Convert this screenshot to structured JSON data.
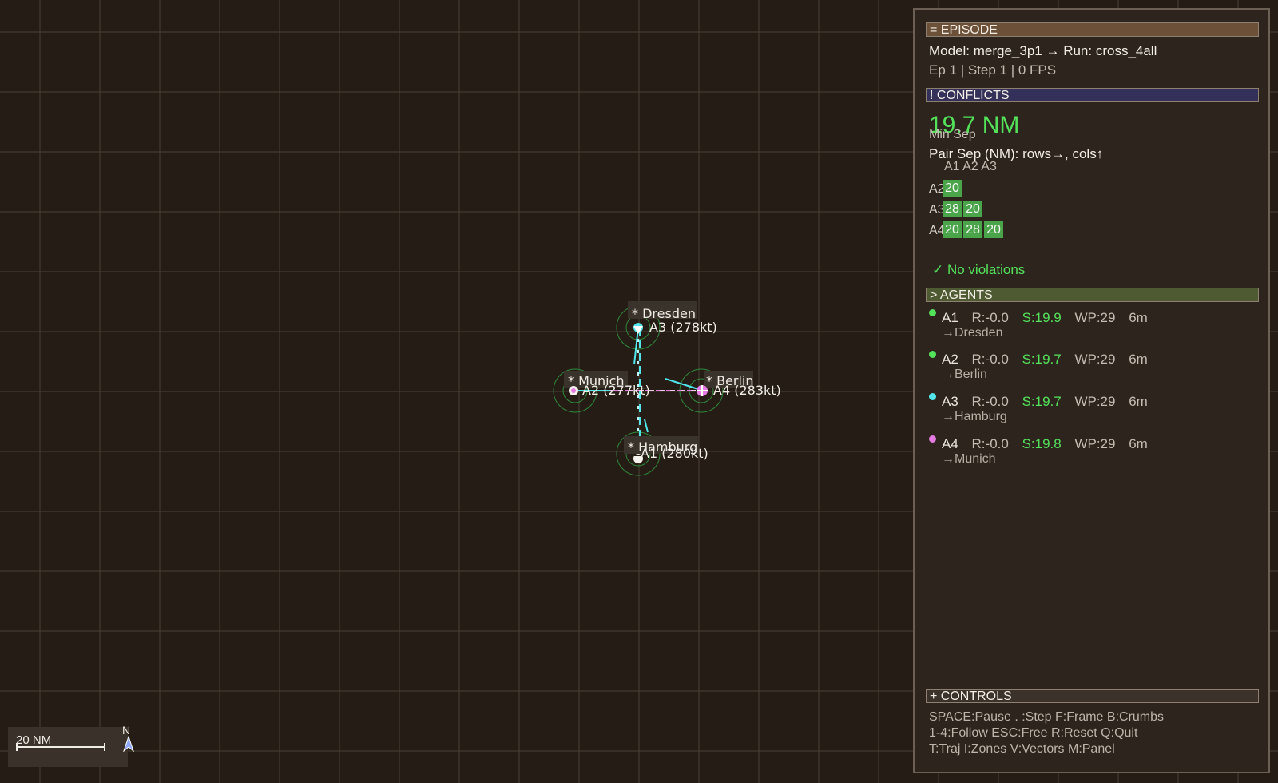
{
  "map": {
    "cities": [
      {
        "name": "* Dresden"
      },
      {
        "name": "* Munich"
      },
      {
        "name": "* Berlin"
      },
      {
        "name": "* Hamburg"
      }
    ],
    "aircraft_labels": [
      {
        "id": "A3",
        "text": "A3 (278kt)"
      },
      {
        "id": "A4",
        "text": "A4 (283kt)"
      },
      {
        "id": "A2",
        "text": "A2 (277kt)"
      },
      {
        "id": "A1",
        "text": "A1 (280kt)"
      }
    ],
    "scale_label": "20 NM",
    "north_label": "N"
  },
  "colors": {
    "background": "#241c15",
    "grid": "#4a4038",
    "agent_A1": "#53e25a",
    "agent_A2": "#53e25a",
    "agent_A3": "#52e6ec",
    "agent_A4": "#e57be2"
  },
  "panel": {
    "episode": {
      "header": "= EPISODE",
      "model_line": "Model: merge_3p1 → Run: cross_4all",
      "status_line": "Ep 1 | Step 1 | 0 FPS"
    },
    "conflicts": {
      "header": "! CONFLICTS",
      "min_sep_value": "19.7 NM",
      "min_sep_label": "Min Sep",
      "pair_sep_label": "Pair Sep (NM):  rows→, cols↑",
      "col_headers": "A1 A2 A3",
      "rows": [
        {
          "label": "A2",
          "values": [
            "20"
          ]
        },
        {
          "label": "A3",
          "values": [
            "28",
            "20"
          ]
        },
        {
          "label": "A4",
          "values": [
            "20",
            "28",
            "20"
          ]
        }
      ],
      "status": "✓ No violations"
    },
    "agents": {
      "header": "> AGENTS",
      "items": [
        {
          "id": "A1",
          "reward": "R:-0.0",
          "sep": "S:19.9",
          "wp": "WP:29",
          "time": "6m",
          "dest": "→Dresden",
          "color": "#53e25a"
        },
        {
          "id": "A2",
          "reward": "R:-0.0",
          "sep": "S:19.7",
          "wp": "WP:29",
          "time": "6m",
          "dest": "→Berlin",
          "color": "#53e25a"
        },
        {
          "id": "A3",
          "reward": "R:-0.0",
          "sep": "S:19.7",
          "wp": "WP:29",
          "time": "6m",
          "dest": "→Hamburg",
          "color": "#52e6ec"
        },
        {
          "id": "A4",
          "reward": "R:-0.0",
          "sep": "S:19.8",
          "wp": "WP:29",
          "time": "6m",
          "dest": "→Munich",
          "color": "#e57be2"
        }
      ]
    },
    "controls": {
      "header": "+ CONTROLS",
      "lines": [
        "SPACE:Pause . :Step F:Frame B:Crumbs",
        "1-4:Follow ESC:Free R:Reset Q:Quit",
        "T:Traj I:Zones V:Vectors M:Panel"
      ]
    }
  }
}
